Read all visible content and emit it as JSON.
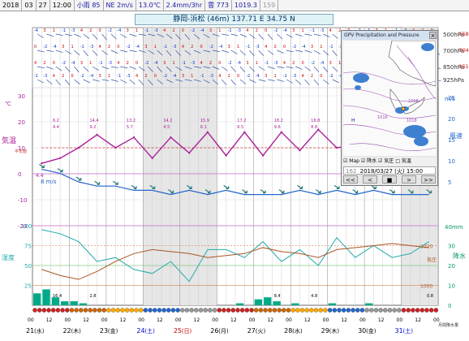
{
  "topbar": {
    "year": "2018",
    "month": "03",
    "day": "27",
    "time": "12:00",
    "precip": "小雨 85",
    "wind": "NE 2m/s",
    "temp": "13.0℃",
    "rain3h": "2.4mm/3hr",
    "cloud": "雲 773",
    "pressure": "1019.3",
    "extra": "159"
  },
  "station_title": "静岡-浜松 (46m)  137.71 E   34.75 N",
  "pressure_levels": [
    "500hPa",
    "700hPa",
    "850hPa",
    "925hPa"
  ],
  "pressure_tags": [
    "5580",
    "3040",
    "1510"
  ],
  "left_axis": {
    "temp_unit": "℃",
    "temp_label": "気温",
    "temp_ticks": [
      "30",
      "20",
      "10",
      "0",
      "-10",
      "-20"
    ],
    "humidity_label": "湿度",
    "humidity_ticks": [
      "100",
      "75",
      "50",
      "25"
    ],
    "temp_note": "平年値",
    "temp_min_value": "4.4",
    "wind_speed_mark": "8 m/s"
  },
  "right_axis": {
    "wind_unit": "m/s",
    "wind_label": "風速",
    "wind_ticks": [
      "25",
      "20",
      "15",
      "10",
      "5"
    ],
    "precip_unit": "40mm",
    "precip_label": "降水",
    "precip_ticks": [
      "30",
      "20",
      "10",
      "0"
    ],
    "press_note": "気圧",
    "precip_note": "月間降水量 ",
    "press_values": [
      "1020",
      "1000"
    ]
  },
  "daily_labels": {
    "max": [
      "6.2",
      "14.4",
      "13.2",
      "14.2",
      "15.9",
      "17.2",
      "18.2",
      "18.8"
    ],
    "min": [
      "4.4",
      "9.2",
      "5.7",
      "4.5",
      "6.1",
      "6.5",
      "9.6",
      "8.8"
    ],
    "precip_sum": [
      "16.4",
      "2.8",
      "",
      "",
      "",
      "",
      "8.4",
      "4.8"
    ],
    "trace_note": "0.8"
  },
  "time_axis": {
    "hours": [
      "00",
      "12",
      "00",
      "12",
      "00",
      "12",
      "00",
      "12",
      "00",
      "12",
      "00",
      "12",
      "00",
      "12",
      "00",
      "12",
      "00",
      "12",
      "00",
      "12",
      "00",
      "12",
      "00"
    ],
    "days": [
      {
        "d": "21",
        "w": "(水)",
        "color": "#000000"
      },
      {
        "d": "22",
        "w": "(木)",
        "color": "#000000"
      },
      {
        "d": "23",
        "w": "(金)",
        "color": "#000000"
      },
      {
        "d": "24",
        "w": "(土)",
        "color": "#0000cc"
      },
      {
        "d": "25",
        "w": "(日)",
        "color": "#cc0000"
      },
      {
        "d": "26",
        "w": "(月)",
        "color": "#000000"
      },
      {
        "d": "27",
        "w": "(火)",
        "color": "#000000"
      },
      {
        "d": "28",
        "w": "(水)",
        "color": "#000000"
      },
      {
        "d": "29",
        "w": "(木)",
        "color": "#000000"
      },
      {
        "d": "30",
        "w": "(金)",
        "color": "#000000"
      },
      {
        "d": "31",
        "w": "(土)",
        "color": "#0000cc"
      }
    ]
  },
  "mappanel": {
    "title": "GPV Precipitation and Pressure",
    "close": "×",
    "options": [
      "☑ Map",
      "☑ 降水",
      "☑ 気圧",
      "□ 気温"
    ],
    "frame": "162",
    "datetime": "2018/03/27 (火) 15:00",
    "nav": [
      "<<",
      "<",
      "■",
      ">",
      ">>"
    ],
    "press_labels": [
      "1016",
      "1008",
      "1018",
      "H"
    ]
  },
  "colors": {
    "temp_line": "#aa2299",
    "wind_line": "#2266cc",
    "humid_line": "#22aaaa",
    "press_line": "#aa5522",
    "precip_bar": "#00aa88",
    "wind_arrow": "#2a7a7a",
    "norm_line": "#cc3333",
    "weekend": "#e6e6e6"
  },
  "chart_data": [
    {
      "type": "line",
      "title": "気温",
      "xlabel": "",
      "ylabel": "℃",
      "x": [
        "21 00",
        "21 12",
        "22 00",
        "22 12",
        "23 00",
        "23 12",
        "24 00",
        "24 12",
        "25 00",
        "25 12",
        "26 00",
        "26 12",
        "27 00",
        "27 12",
        "28 00",
        "28 12",
        "29 00",
        "29 12",
        "30 00",
        "30 12",
        "31 00",
        "31 12"
      ],
      "ylim": [
        -20,
        30
      ],
      "series": [
        {
          "name": "気温",
          "values": [
            4,
            6,
            10,
            15,
            10,
            14,
            6,
            14,
            8,
            16,
            7,
            16,
            7,
            16,
            9,
            17,
            10,
            11,
            10,
            10,
            10,
            10
          ]
        },
        {
          "name": "平年値",
          "values": [
            10,
            10,
            10,
            10,
            10,
            10,
            10,
            10,
            10,
            10,
            10,
            10,
            10,
            10,
            10,
            10,
            10,
            10,
            10,
            10,
            10,
            10
          ]
        }
      ]
    },
    {
      "type": "line",
      "title": "風速",
      "ylabel": "m/s",
      "ylim": [
        0,
        25
      ],
      "series": [
        {
          "name": "風速",
          "values": [
            8,
            7,
            5,
            4,
            4,
            3,
            3,
            2,
            3,
            2,
            3,
            2,
            2,
            2,
            3,
            2,
            3,
            2,
            3,
            2,
            2,
            2
          ]
        }
      ]
    },
    {
      "type": "line",
      "title": "湿度",
      "ylabel": "%",
      "ylim": [
        0,
        100
      ],
      "series": [
        {
          "name": "湿度",
          "values": [
            95,
            90,
            80,
            55,
            60,
            45,
            40,
            55,
            30,
            70,
            70,
            60,
            80,
            55,
            70,
            50,
            85,
            60,
            75,
            60,
            65,
            80
          ]
        },
        {
          "name": "気圧",
          "values": [
            1008,
            1005,
            1003,
            1007,
            1012,
            1016,
            1018,
            1017,
            1016,
            1014,
            1015,
            1016,
            1019,
            1017,
            1016,
            1014,
            1018,
            1019,
            1020,
            1021,
            1020,
            1019
          ]
        }
      ]
    },
    {
      "type": "bar",
      "title": "降水",
      "ylabel": "mm",
      "ylim": [
        0,
        40
      ],
      "categories": [
        "21 00",
        "21 06",
        "21 12",
        "21 18",
        "22 00",
        "22 06",
        "26 12",
        "27 00",
        "27 06",
        "27 12",
        "28 00",
        "29 00",
        "30 00"
      ],
      "values": [
        6,
        8,
        4,
        2,
        2,
        1,
        1,
        3,
        4,
        2,
        1,
        1,
        1
      ]
    }
  ]
}
